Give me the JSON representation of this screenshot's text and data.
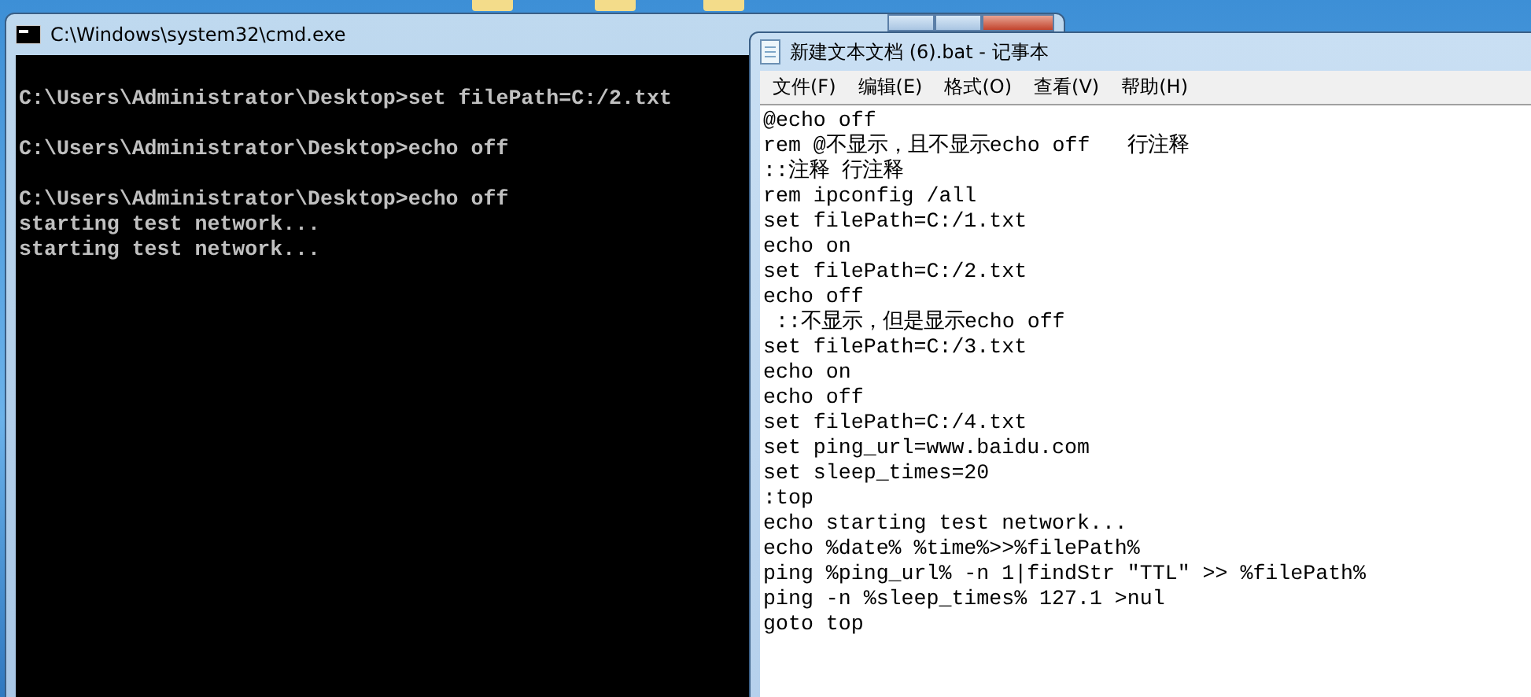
{
  "console": {
    "title": "C:\\Windows\\system32\\cmd.exe",
    "blocks": [
      [
        "C:\\Users\\Administrator\\Desktop>set filePath=C:/2.txt"
      ],
      [
        "C:\\Users\\Administrator\\Desktop>echo off"
      ],
      [
        "C:\\Users\\Administrator\\Desktop>echo off",
        "starting test network...",
        "starting test network..."
      ]
    ]
  },
  "notepad": {
    "title": "新建文本文档 (6).bat - 记事本",
    "menu": [
      "文件(F)",
      "编辑(E)",
      "格式(O)",
      "查看(V)",
      "帮助(H)"
    ],
    "lines": [
      "@echo off",
      "rem @不显示，且不显示echo off   行注释",
      "::注释 行注释",
      "rem ipconfig /all",
      "set filePath=C:/1.txt",
      "echo on",
      "set filePath=C:/2.txt",
      "echo off",
      " ::不显示，但是显示echo off",
      "set filePath=C:/3.txt",
      "echo on",
      "echo off",
      "set filePath=C:/4.txt",
      "set ping_url=www.baidu.com",
      "set sleep_times=20",
      ":top",
      "echo starting test network...",
      "echo %date% %time%>>%filePath%",
      "ping %ping_url% -n 1|findStr \"TTL\" >> %filePath%",
      "ping -n %sleep_times% 127.1 >nul",
      "goto top"
    ]
  }
}
